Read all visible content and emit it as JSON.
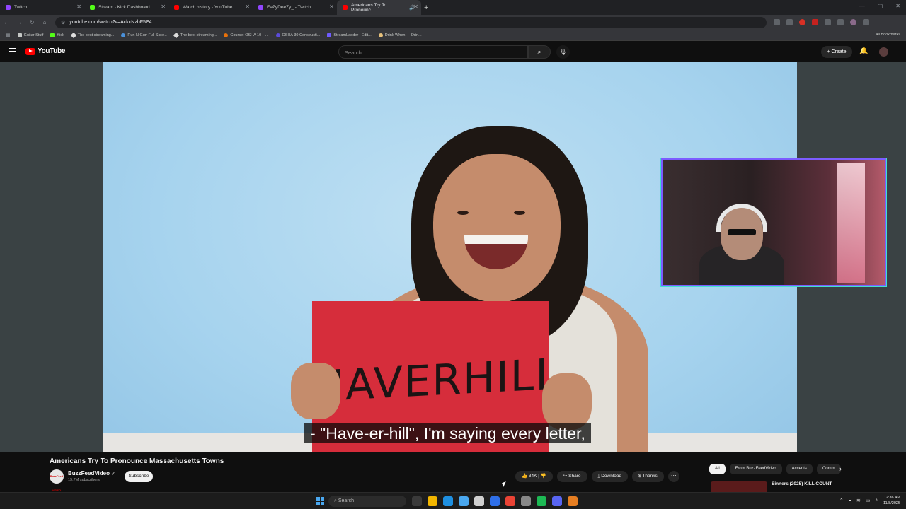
{
  "browser": {
    "tabs": [
      {
        "label": "Twitch",
        "color": "#9146ff"
      },
      {
        "label": "Stream - Kick Dashboard",
        "color": "#53fc18"
      },
      {
        "label": "Watch history - YouTube",
        "color": "#ff0000"
      },
      {
        "label": "EaZyDeeZy_ - Twitch",
        "color": "#9146ff"
      },
      {
        "label": "Americans Try To Pronounc",
        "color": "#ff0000",
        "active": true
      }
    ],
    "url": "youtube.com/watch?v=AckcNzbF5E4",
    "bookmarks": [
      "Guitar Stuff",
      "Kick",
      "The best streaming...",
      "Run N Gun Full Scre...",
      "The best streaming...",
      "Course: OSHA 10-H...",
      "OSHA 30 Constructi...",
      "StreamLadder | Edit...",
      "Drink When — Drin..."
    ],
    "all_bookmarks": "All Bookmarks"
  },
  "youtube": {
    "logo": "YouTube",
    "search_placeholder": "Search",
    "create_label": "Create"
  },
  "video": {
    "sign_text": "HAVERHILL",
    "caption": "- \"Have-er-hill\", I'm saying every letter,"
  },
  "meta": {
    "title": "Americans Try To Pronounce Massachusetts Towns",
    "channel": "BuzzFeedVideo",
    "channel_avatar_text": "BuzzFeed VIDEO",
    "subscribers": "19.7M subscribers",
    "subscribe_label": "Subscribe",
    "likes": "34K",
    "share_label": "Share",
    "download_label": "Download",
    "thanks_label": "Thanks",
    "more_label": "···"
  },
  "chips": [
    "All",
    "From BuzzFeedVideo",
    "Accents",
    "Comm"
  ],
  "recommendation": {
    "title": "Sinners (2025) KILL COUNT"
  },
  "taskbar": {
    "search_placeholder": "Search",
    "time": "12:36 AM",
    "date": "11/8/2025",
    "app_colors": [
      "#3a3a3a",
      "#f2b600",
      "#1e8fe0",
      "#4aa8f0",
      "#cfcfcf",
      "#2f6fe8",
      "#ea4335",
      "#888",
      "#1db954",
      "#5865f2",
      "#e67e22"
    ]
  }
}
